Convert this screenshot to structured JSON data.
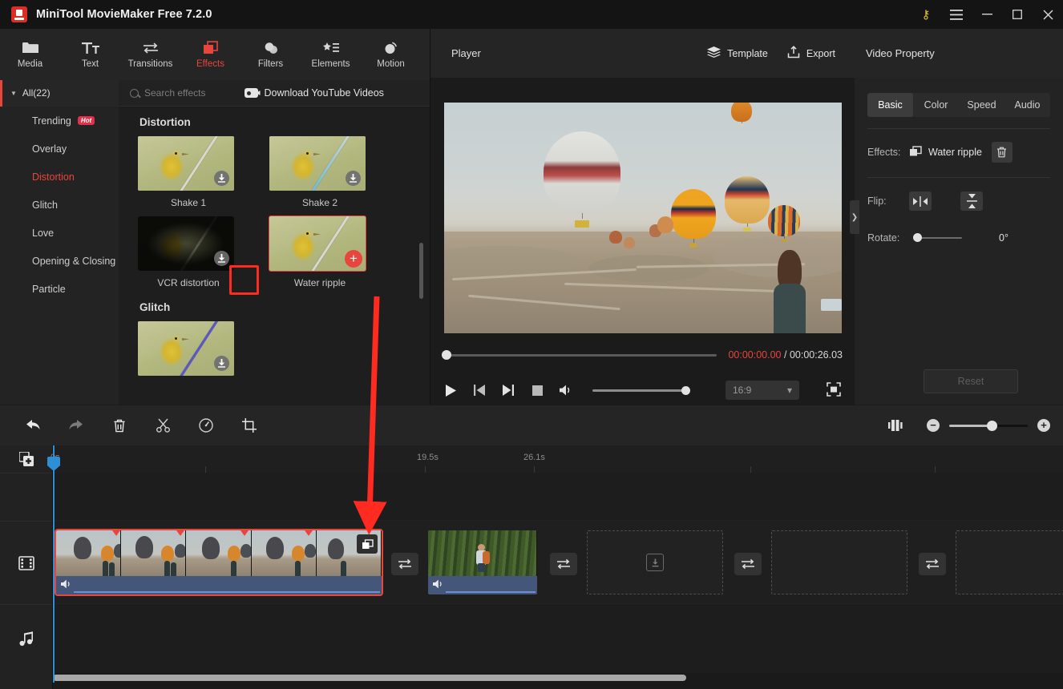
{
  "window": {
    "title": "MiniTool MovieMaker Free 7.2.0",
    "logo_icon": "app-logo-icon",
    "controls": {
      "key": "key-icon",
      "menu": "hamburger-menu-icon",
      "minimize": "minimize-icon",
      "maximize": "maximize-icon",
      "close": "close-icon"
    }
  },
  "topnav": {
    "items": [
      {
        "label": "Media",
        "icon": "folder-icon",
        "active": false
      },
      {
        "label": "Text",
        "icon": "text-icon",
        "active": false
      },
      {
        "label": "Transitions",
        "icon": "transitions-icon",
        "active": false
      },
      {
        "label": "Effects",
        "icon": "effects-icon",
        "active": true
      },
      {
        "label": "Filters",
        "icon": "filters-icon",
        "active": false
      },
      {
        "label": "Elements",
        "icon": "elements-icon",
        "active": false
      },
      {
        "label": "Motion",
        "icon": "motion-icon",
        "active": false
      }
    ]
  },
  "subbar": {
    "all_label": "All(22)",
    "search_placeholder": "Search effects",
    "search_value": "",
    "download_label": "Download YouTube Videos"
  },
  "categories": [
    {
      "label": "Trending",
      "badge": "Hot",
      "active": false
    },
    {
      "label": "Overlay",
      "badge": "",
      "active": false
    },
    {
      "label": "Distortion",
      "badge": "",
      "active": true
    },
    {
      "label": "Glitch",
      "badge": "",
      "active": false
    },
    {
      "label": "Love",
      "badge": "",
      "active": false
    },
    {
      "label": "Opening & Closing",
      "badge": "",
      "active": false
    },
    {
      "label": "Particle",
      "badge": "",
      "active": false
    }
  ],
  "effects": {
    "section1_title": "Distortion",
    "section2_title": "Glitch",
    "items": [
      {
        "label": "Shake 1",
        "badge": "download",
        "selected": false
      },
      {
        "label": "Shake 2",
        "badge": "download",
        "selected": false
      },
      {
        "label": "VCR distortion",
        "badge": "download",
        "selected": false
      },
      {
        "label": "Water ripple",
        "badge": "add",
        "selected": true
      }
    ]
  },
  "player": {
    "title": "Player",
    "template_label": "Template",
    "export_label": "Export",
    "current_time": "00:00:00.00",
    "separator": "/",
    "total_time": "00:00:26.03",
    "aspect_ratio": "16:9",
    "controls": {
      "play": "play-icon",
      "prev_frame": "previous-frame-icon",
      "next_frame": "next-frame-icon",
      "stop": "stop-icon",
      "volume": "volume-icon",
      "fullscreen": "fullscreen-icon"
    }
  },
  "properties": {
    "title": "Video Property",
    "tabs": [
      {
        "label": "Basic",
        "active": true
      },
      {
        "label": "Color",
        "active": false
      },
      {
        "label": "Speed",
        "active": false
      },
      {
        "label": "Audio",
        "active": false
      }
    ],
    "effects_label": "Effects:",
    "effect_name": "Water ripple",
    "flip_label": "Flip:",
    "rotate_label": "Rotate:",
    "rotate_value": "0°",
    "reset_label": "Reset"
  },
  "toolbar": {
    "items": [
      {
        "icon": "undo-icon",
        "name": "undo-button"
      },
      {
        "icon": "redo-icon",
        "name": "redo-button"
      },
      {
        "icon": "delete-icon",
        "name": "delete-button"
      },
      {
        "icon": "split-icon",
        "name": "split-button"
      },
      {
        "icon": "speed-icon",
        "name": "speed-button"
      },
      {
        "icon": "crop-icon",
        "name": "crop-button"
      }
    ],
    "fit_icon": "fit-timeline-icon",
    "zoom_out": "−",
    "zoom_in": "+"
  },
  "timeline": {
    "ruler_ticks": [
      "0s",
      "19.5s",
      "26.1s"
    ],
    "track_icons": {
      "add_media": "add-media-icon",
      "video_track": "film-strip-icon",
      "audio_track": "music-note-icon"
    },
    "clips": [
      {
        "name": "balloon-clip",
        "selected": true,
        "has_effect_badge": true,
        "muted": false
      },
      {
        "name": "forest-clip",
        "selected": false,
        "has_effect_badge": false,
        "muted": false
      }
    ],
    "transitions": [
      {
        "name": "transition-slot-1",
        "icon": "transition-icon"
      },
      {
        "name": "transition-slot-2",
        "icon": "transition-icon"
      },
      {
        "name": "transition-slot-3",
        "icon": "transition-icon"
      }
    ],
    "placeholders": [
      {
        "name": "empty-slot-1",
        "icon": "download-icon"
      },
      {
        "name": "empty-slot-2",
        "icon": ""
      },
      {
        "name": "empty-slot-3",
        "icon": ""
      }
    ]
  },
  "annotation": {
    "highlight_target": "vcr-distortion-download-badge",
    "arrow_from": "water-ripple-add-badge",
    "arrow_to": "timeline-clip-effect-badge",
    "color": "#ff2a20"
  }
}
